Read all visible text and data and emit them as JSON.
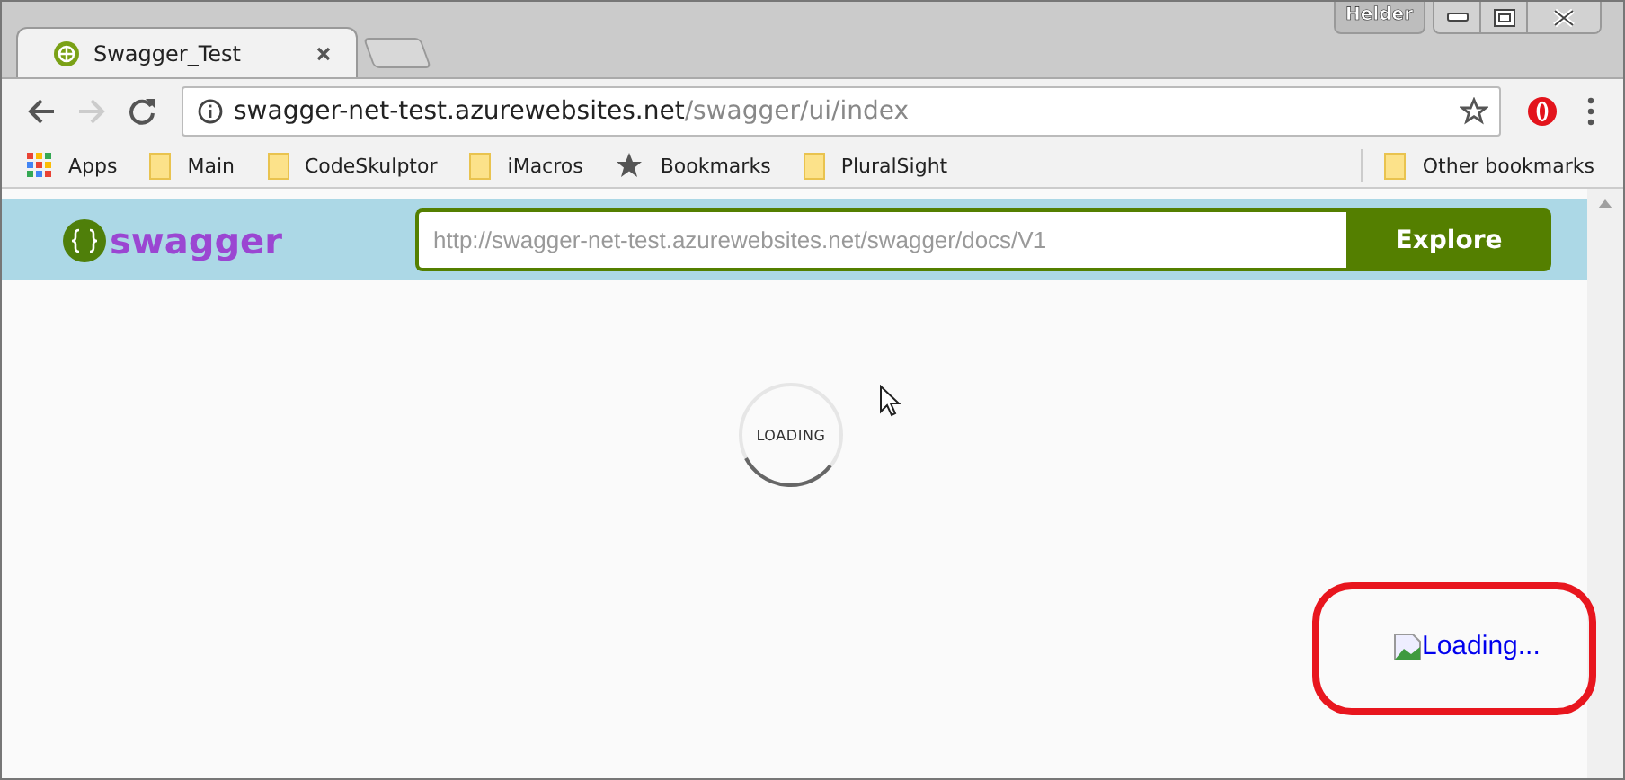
{
  "window": {
    "user": "Helder"
  },
  "tabs": [
    {
      "title": "Swagger_Test",
      "selected": true
    }
  ],
  "address_bar": {
    "host": "swagger-net-test.azurewebsites.net",
    "path": "/swagger/ui/index"
  },
  "bookmarks": [
    {
      "label": "Apps",
      "kind": "apps"
    },
    {
      "label": "Main",
      "kind": "folder"
    },
    {
      "label": "CodeSkulptor",
      "kind": "folder"
    },
    {
      "label": "iMacros",
      "kind": "folder"
    },
    {
      "label": "Bookmarks",
      "kind": "star"
    },
    {
      "label": "PluralSight",
      "kind": "folder"
    }
  ],
  "other_bookmarks": "Other bookmarks",
  "swagger": {
    "logo": "swagger",
    "url_placeholder": "http://swagger-net-test.azurewebsites.net/swagger/docs/V1",
    "explore": "Explore"
  },
  "spinner": {
    "label": "LOADING"
  },
  "broken_image": {
    "alt": "Loading..."
  }
}
